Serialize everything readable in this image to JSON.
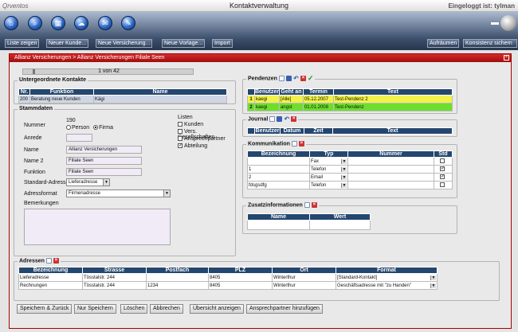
{
  "window": {
    "logo": "Qrventos",
    "title": "Kontaktverwaltung",
    "login": "Eingeloggt ist: tylman"
  },
  "toolbar": {
    "buttons": [
      "Liste zeigen",
      "Neuer Kunde...",
      "Neue Versicherung...",
      "Neue Vorlage...",
      "Import"
    ],
    "right_buttons": [
      "Aufräumen",
      "Konsistenz sichern"
    ],
    "icons": [
      "home-icon",
      "search-icon",
      "calendar-icon",
      "cloud-icon",
      "mail-icon",
      "wrench-icon"
    ]
  },
  "panel": {
    "breadcrumb": "Allianz Versicherungen  > Allianz Versicherungen Filiale Seen",
    "pager": "1 von 42"
  },
  "untergeordnete": {
    "title": "Untergeordnete Kontakte",
    "headers": [
      "Nr.",
      "Funktion",
      "Name"
    ],
    "rows": [
      [
        "200",
        "Beratung neue Kunden",
        "Kägi"
      ]
    ]
  },
  "stammdaten": {
    "title": "Stammdaten",
    "nummer_label": "Nummer",
    "nummer": "190",
    "radio_person": "Person",
    "radio_firma": "Firma",
    "anrede_label": "Anrede",
    "name_label": "Name",
    "name": "Allianz Versicherungen",
    "name2_label": "Name 2",
    "name2": "Filiale Seen",
    "funktion_label": "Funktion",
    "funktion": "Filiale Seen",
    "std_adresse_label": "Standard-Adresse",
    "std_adresse": "Lieferadresse",
    "adressformat_label": "Adressformat",
    "adressformat": "Firmenadresse",
    "bemerkungen_label": "Bemerkungen",
    "listen_label": "Listen",
    "listen": [
      {
        "label": "Kunden",
        "checked": false
      },
      {
        "label": "Vers. Gesellschaften",
        "checked": false
      },
      {
        "label": "Ansprechpartner",
        "checked": false
      },
      {
        "label": "Abteilung",
        "checked": true
      }
    ]
  },
  "pendenzen": {
    "title": "Pendenzen",
    "headers": [
      "Benutzer",
      "Geht an",
      "Termin",
      "Text"
    ],
    "rows": [
      {
        "n": "1",
        "benutzer": "kaegi",
        "geht": "[Alle]",
        "termin": "05.12.2007",
        "text": "Test-Pendenz 2",
        "color": "#f2f24a"
      },
      {
        "n": "2",
        "benutzer": "kaegi",
        "geht": "angst",
        "termin": "01.01.2008",
        "text": "Test-Pendenz",
        "color": "#6cdf2c"
      }
    ]
  },
  "journal": {
    "title": "Journal",
    "headers": [
      "Benutzer",
      "Datum",
      "Zeit",
      "Text"
    ]
  },
  "kommunikation": {
    "title": "Kommunikation",
    "headers": [
      "Bezeichnung",
      "Typ",
      "Nummer",
      "Std"
    ],
    "rows": [
      {
        "bez": "",
        "typ": "Fax",
        "nr": "",
        "std": false
      },
      {
        "bez": "1",
        "typ": "Telefon",
        "nr": "",
        "std": true
      },
      {
        "bez": "2",
        "typ": "Email",
        "nr": "",
        "std": true
      },
      {
        "bez": "fdsgsdfg",
        "typ": "Telefon",
        "nr": "",
        "std": false
      }
    ]
  },
  "zusatz": {
    "title": "Zusatzinformationen",
    "headers": [
      "Name",
      "Wert"
    ]
  },
  "adressen": {
    "title": "Adressen",
    "headers": [
      "Bezeichnung",
      "Strasse",
      "Postfach",
      "PLZ",
      "Ort",
      "Format"
    ],
    "rows": [
      {
        "bez": "Lieferadresse",
        "str": "Tösstalstr. 244",
        "pf": "",
        "plz": "8405",
        "ort": "Winterthur",
        "fmt": "[Standard-Kontakt]"
      },
      {
        "bez": "Rechnungen",
        "str": "Tösstalstr. 244",
        "pf": "1234",
        "plz": "8405",
        "ort": "Winterthur",
        "fmt": "Geschäftsadresse mit \"zu Handen\""
      }
    ]
  },
  "buttons": [
    "Speichern & Zurück",
    "Nur Speichern",
    "Löschen",
    "Abbrechen",
    "Übersicht anzeigen",
    "Ansprechpartner hinzufügen"
  ]
}
